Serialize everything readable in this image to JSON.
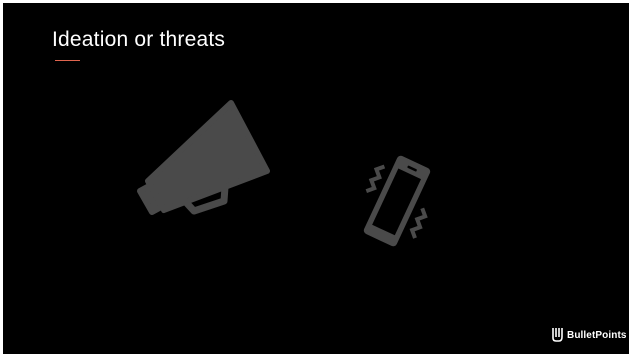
{
  "slide": {
    "title": "Ideation or threats",
    "accent_color": "#e0654f",
    "background_color": "#000000",
    "icon_color": "#4a4a4a"
  },
  "icons": [
    "megaphone-icon",
    "vibrating-phone-icon"
  ],
  "brand": {
    "name": "BulletPoints",
    "logo_icon": "bulletpoints-logo-icon"
  }
}
